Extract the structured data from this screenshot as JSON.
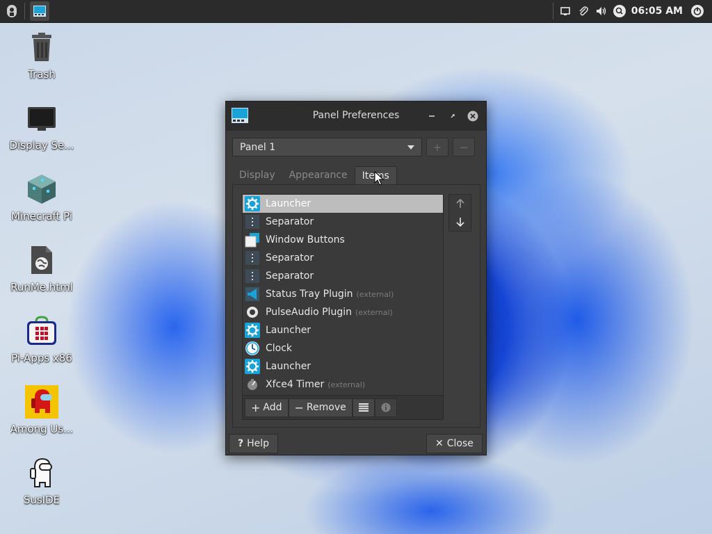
{
  "top_panel": {
    "clock": "06:05 AM",
    "tray_icons": [
      "display-icon",
      "paperclip-icon",
      "volume-icon",
      "search-icon",
      "power-icon"
    ]
  },
  "desktop": {
    "icons": [
      {
        "label": "Trash",
        "icon": "trash-icon"
      },
      {
        "label": "Display Se...",
        "icon": "monitor-icon"
      },
      {
        "label": "Minecraft Pi",
        "icon": "minecraft-icon"
      },
      {
        "label": "RunMe.html",
        "icon": "html-file-icon"
      },
      {
        "label": "Pi-Apps x86",
        "icon": "pi-apps-icon"
      },
      {
        "label": "Among Us...",
        "icon": "among-us-icon"
      },
      {
        "label": "SusIDE",
        "icon": "suside-icon"
      }
    ]
  },
  "dialog": {
    "title": "Panel Preferences",
    "panel_select": "Panel 1",
    "add_panel": "+",
    "remove_panel": "−",
    "tabs": [
      {
        "label": "Display",
        "active": false
      },
      {
        "label": "Appearance",
        "active": false
      },
      {
        "label": "Items",
        "active": true
      }
    ],
    "items": [
      {
        "name": "Launcher",
        "ext": "",
        "icon": "launcher-gear-icon",
        "selected": true
      },
      {
        "name": "Separator",
        "ext": "",
        "icon": "separator-icon"
      },
      {
        "name": "Window Buttons",
        "ext": "",
        "icon": "window-buttons-icon"
      },
      {
        "name": "Separator",
        "ext": "",
        "icon": "separator-icon"
      },
      {
        "name": "Separator",
        "ext": "",
        "icon": "separator-icon"
      },
      {
        "name": "Status Tray Plugin",
        "ext": "(external)",
        "icon": "megaphone-icon"
      },
      {
        "name": "PulseAudio Plugin",
        "ext": "(external)",
        "icon": "speaker-icon"
      },
      {
        "name": "Launcher",
        "ext": "",
        "icon": "launcher-gear-icon"
      },
      {
        "name": "Clock",
        "ext": "",
        "icon": "clock-icon"
      },
      {
        "name": "Launcher",
        "ext": "",
        "icon": "launcher-gear-icon"
      },
      {
        "name": "Xfce4 Timer",
        "ext": "(external)",
        "icon": "timer-icon"
      }
    ],
    "toolbar": {
      "add": "Add",
      "remove": "Remove"
    },
    "help_label": "Help",
    "close_label": "Close"
  },
  "colors": {
    "accent": "#1aa3d9",
    "selected_row": "#bdbdbd",
    "dialog_bg": "#3c3c3c"
  }
}
